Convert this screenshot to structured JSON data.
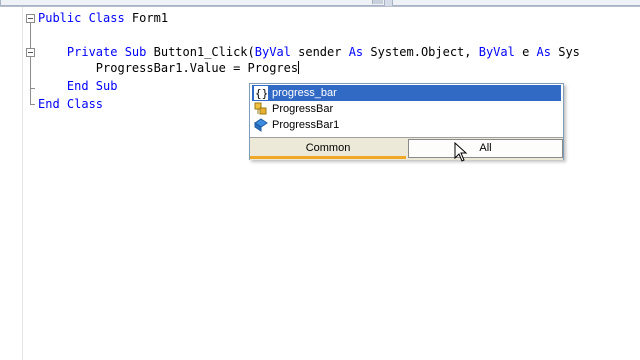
{
  "editor": {
    "lines": [
      {
        "parts": [
          {
            "t": "Public Class",
            "kw": true
          },
          {
            "t": " Form1",
            "kw": false
          }
        ]
      },
      {
        "parts": []
      },
      {
        "parts": [
          {
            "t": "    "
          },
          {
            "t": "Private Sub",
            "kw": true
          },
          {
            "t": " Button1_Click("
          },
          {
            "t": "ByVal",
            "kw": true
          },
          {
            "t": " sender "
          },
          {
            "t": "As",
            "kw": true
          },
          {
            "t": " System.Object, "
          },
          {
            "t": "ByVal",
            "kw": true
          },
          {
            "t": " e "
          },
          {
            "t": "As",
            "kw": true
          },
          {
            "t": " Sys"
          }
        ]
      },
      {
        "parts": [
          {
            "t": "        ProgressBar1.Value = Progres"
          }
        ],
        "caret": true
      },
      {
        "parts": [
          {
            "t": "    "
          },
          {
            "t": "End Sub",
            "kw": true
          }
        ]
      },
      {
        "parts": [
          {
            "t": "End Class",
            "kw": true
          }
        ]
      }
    ]
  },
  "completion": {
    "items": [
      {
        "label": "progress_bar",
        "icon": "namespace-icon",
        "selected": true
      },
      {
        "label": "ProgressBar",
        "icon": "class-icon",
        "selected": false
      },
      {
        "label": "ProgressBar1",
        "icon": "field-icon",
        "selected": false
      }
    ],
    "tabs": {
      "common": "Common",
      "all": "All"
    }
  },
  "colors": {
    "keyword": "#0000ff",
    "selection": "#316ac5",
    "tab_accent": "#f0a828"
  }
}
